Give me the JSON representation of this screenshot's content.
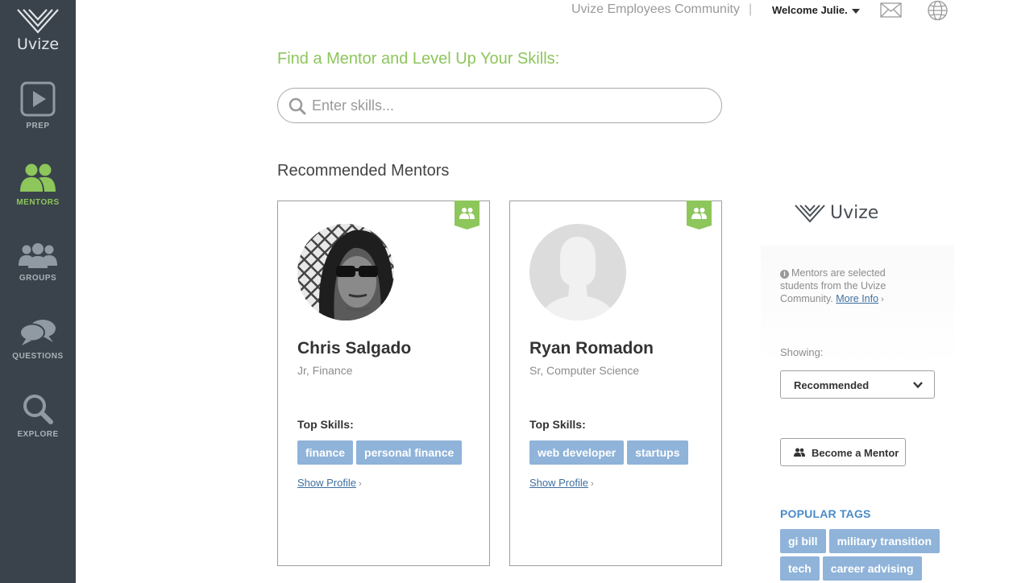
{
  "app": {
    "logo_text": "Uvize"
  },
  "sidebar": {
    "items": [
      {
        "label": "PREP",
        "icon": "play-icon"
      },
      {
        "label": "MENTORS",
        "icon": "mentors-icon",
        "active": true
      },
      {
        "label": "GROUPS",
        "icon": "groups-icon"
      },
      {
        "label": "QUESTIONS",
        "icon": "chat-icon"
      },
      {
        "label": "EXPLORE",
        "icon": "search-icon"
      }
    ]
  },
  "topbar": {
    "community": "Uvize Employees Community",
    "separator": "|",
    "welcome": "Welcome Julie."
  },
  "main": {
    "headline": "Find a Mentor and Level Up Your Skills:",
    "search_placeholder": "Enter skills...",
    "section_title": "Recommended Mentors",
    "mentors": [
      {
        "name": "Chris Salgado",
        "subtitle": "Jr, Finance",
        "skills_title": "Top Skills:",
        "skills": [
          "finance",
          "personal finance"
        ],
        "link": "Show Profile",
        "link_suffix": "›"
      },
      {
        "name": "Ryan Romadon",
        "subtitle": "Sr, Computer Science",
        "skills_title": "Top Skills:",
        "skills": [
          "web developer",
          "startups"
        ],
        "link": "Show Profile",
        "link_suffix": "›"
      }
    ]
  },
  "rightpanel": {
    "logo_text": "Uvize",
    "info_text": "Mentors are selected students from the Uvize Community.",
    "info_link": "More Info",
    "info_link_suffix": "›",
    "showing_label": "Showing:",
    "showing_value": "Recommended",
    "become_label": "Become a Mentor",
    "popular_title": "POPULAR TAGS",
    "popular_tags_row1": [
      "gi bill",
      "military transition"
    ],
    "popular_tags_row2": [
      "tech",
      "career advising"
    ]
  },
  "colors": {
    "sidebar_bg": "#3a434b",
    "accent_green": "#8dc65b",
    "tag_blue": "#8fb3d9",
    "link_blue": "#3e6f9f",
    "popular_blue": "#4a8bc8"
  }
}
